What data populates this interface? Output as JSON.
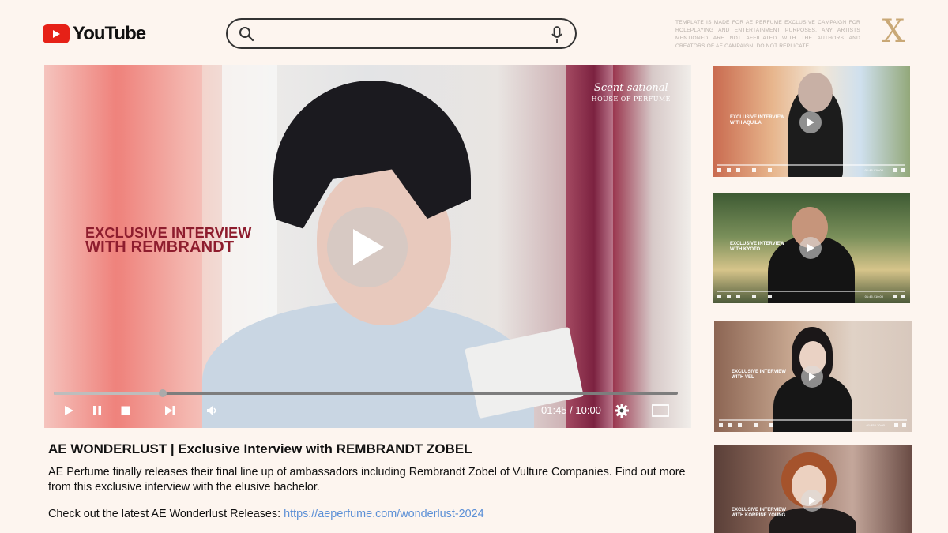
{
  "header": {
    "logo_text": "YouTube",
    "search": {
      "placeholder": ""
    },
    "disclaimer": "TEMPLATE IS MADE FOR AE PERFUME EXCLUSIVE CAMPAIGN FOR ROLEPLAYING AND ENTERTAINMENT PURPOSES. ANY ARTISTS MENTIONED ARE NOT AFFILIATED WITH THE AUTHORS AND CREATORS OF AE CAMPAIGN. DO NOT REPLICATE.",
    "monogram": "X"
  },
  "player": {
    "brand_script": "Scent-sational",
    "brand_house": "HOUSE OF PERFUME",
    "overlay_line1": "EXCLUSIVE INTERVIEW",
    "overlay_line2": "WITH REMBRANDT",
    "progress_percent": 17.5,
    "time": "01:45 / 10:00"
  },
  "video": {
    "title": "AE WONDERLUST | Exclusive Interview with REMBRANDT ZOBEL",
    "description": "AE Perfume finally releases their final line up of ambassadors including Rembrandt Zobel of Vulture Companies. Find out more from this exclusive interview with the elusive bachelor.",
    "cta_text": "Check out the latest AE Wonderlust Releases: ",
    "cta_link": "https://aeperfume.com/wonderlust-2024"
  },
  "thumbnails": [
    {
      "label1": "EXCLUSIVE INTERVIEW",
      "label2": "WITH AQUILA",
      "time": "01:45 / 10:00"
    },
    {
      "label1": "EXCLUSIVE INTERVIEW",
      "label2": "WITH KYOTO",
      "time": "01:45 / 10:00"
    },
    {
      "label1": "EXCLUSIVE INTERVIEW",
      "label2": "WITH VEL",
      "time": "01:45 / 10:00"
    },
    {
      "label1": "EXCLUSIVE INTERVIEW",
      "label2": "WITH KORRINE YOUNG",
      "time": ""
    }
  ],
  "colors": {
    "background": "#fdf5ef",
    "youtube_red": "#e62117",
    "overlay_title": "#8e1d2e",
    "link": "#5b8fd6"
  }
}
